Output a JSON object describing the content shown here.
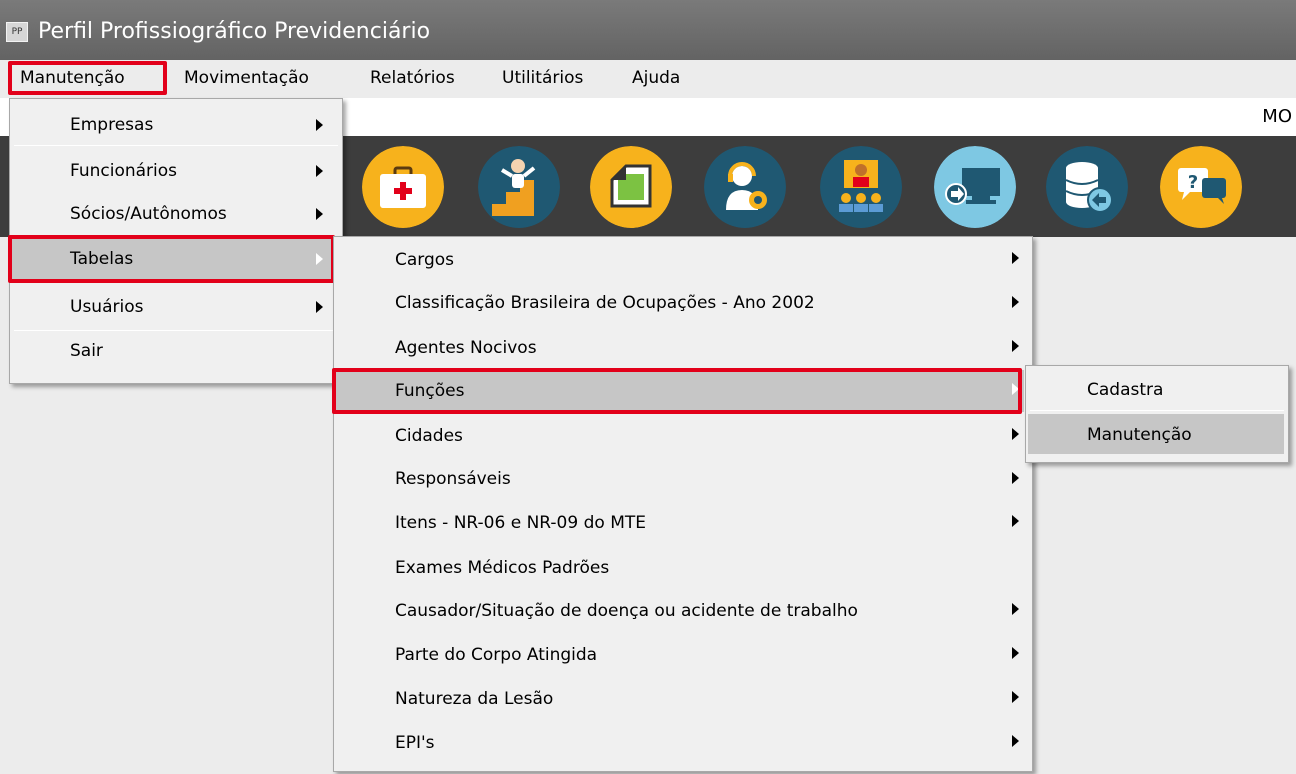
{
  "window": {
    "title": "Perfil Profissiográfico Previdenciário",
    "app_icon_text": "PP"
  },
  "menubar": {
    "items": [
      "Manutenção",
      "Movimentação",
      "Relatórios",
      "Utilitários",
      "Ajuda"
    ]
  },
  "status_strip": {
    "text": "MO"
  },
  "toolbar": {
    "buttons": [
      {
        "icon": "medical-kit-icon"
      },
      {
        "icon": "falling-person-stairs-icon"
      },
      {
        "icon": "document-fold-icon"
      },
      {
        "icon": "support-agent-gear-icon"
      },
      {
        "icon": "presenter-audience-icon"
      },
      {
        "icon": "monitor-arrow-icon"
      },
      {
        "icon": "database-arrow-icon"
      },
      {
        "icon": "help-chat-icon"
      }
    ]
  },
  "menu_manutencao": {
    "items": [
      "Empresas",
      "Funcionários",
      "Sócios/Autônomos",
      "Tabelas",
      "Usuários",
      "Sair"
    ]
  },
  "menu_tabelas": {
    "items": [
      "Cargos",
      "Classificação Brasileira de Ocupações - Ano 2002",
      "Agentes Nocivos",
      "Funções",
      "Cidades",
      "Responsáveis",
      "Itens - NR-06 e NR-09 do MTE",
      "Exames Médicos Padrões",
      "Causador/Situação de doença ou acidente de trabalho",
      "Parte do Corpo Atingida",
      "Natureza da Lesão",
      "EPI's"
    ]
  },
  "menu_funcoes": {
    "items": [
      "Cadastra",
      "Manutenção"
    ]
  },
  "colors": {
    "highlight_border": "#e2001a",
    "toolbar_bg": "#3d3d3d",
    "titlebar_bg": "#6e6e6e"
  }
}
